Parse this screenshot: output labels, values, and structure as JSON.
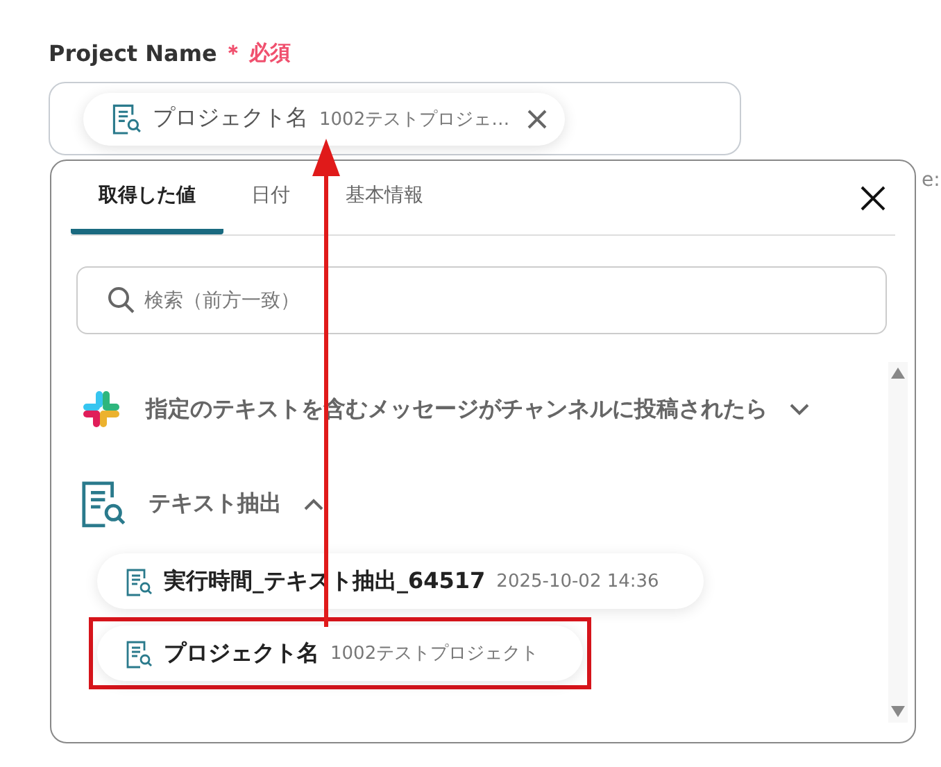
{
  "field": {
    "label": "Project Name",
    "required_mark": "＊",
    "required": "必須",
    "token": {
      "name": "プロジェクト名",
      "value": "1002テストプロジェ…"
    }
  },
  "behind_text": "e:",
  "popup": {
    "tabs": [
      {
        "label": "取得した値",
        "selected": true
      },
      {
        "label": "日付",
        "selected": false
      },
      {
        "label": "基本情報",
        "selected": false
      }
    ],
    "search": {
      "placeholder": "検索（前方一致）"
    },
    "groups": [
      {
        "kind": "slack",
        "title": "指定のテキストを含むメッセージがチャンネルに投稿されたら",
        "expanded": false
      },
      {
        "kind": "doc",
        "title": "テキスト抽出",
        "expanded": true,
        "items": [
          {
            "name": "実行時間_テキスト抽出_64517",
            "value": "2025-10-02 14:36",
            "highlighted": false
          },
          {
            "name": "プロジェクト名",
            "value": "1002テストプロジェクト",
            "highlighted": true
          }
        ]
      }
    ]
  }
}
